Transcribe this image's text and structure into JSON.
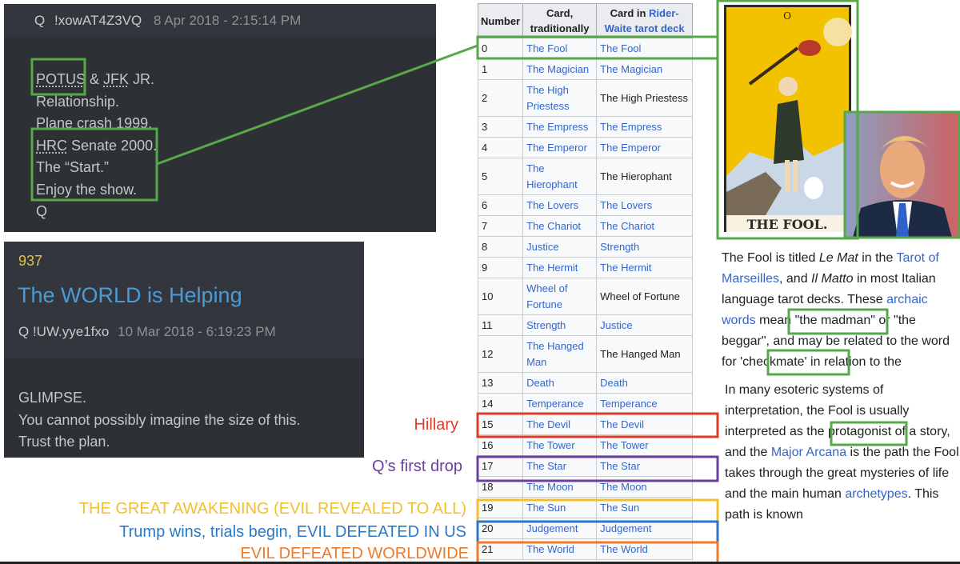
{
  "post1": {
    "q": "Q",
    "trip": "!xowAT4Z3VQ",
    "timestamp": "8 Apr 2018 - 2:15:14 PM",
    "potus": "POTUS",
    "amp": " & ",
    "jfk": "JFK",
    "jr": " JR.",
    "line2": "Relationship.",
    "line3": "Plane crash 1999.",
    "hrc": "HRC",
    "senate": " Senate 2000.",
    "line5": "The “Start.”",
    "line6": "Enjoy the show.",
    "sign": "Q"
  },
  "post2": {
    "number": "937",
    "title": "The WORLD is Helping",
    "trip": "Q  !UW.yye1fxo",
    "timestamp": "10 Mar 2018 - 6:19:23 PM",
    "line1": "GLIMPSE.",
    "line2": "You cannot possibly imagine the size of this.",
    "line3": "Trust the plan."
  },
  "table": {
    "head_number": "Number",
    "head_trad": "Card, traditionally",
    "head_rw_prefix": "Card in ",
    "head_rw_link": "Rider-Waite tarot deck",
    "rows": [
      {
        "n": "0",
        "trad": "The Fool",
        "rw": "The Fool",
        "rw_link": true
      },
      {
        "n": "1",
        "trad": "The Magician",
        "rw": "The Magician",
        "rw_link": true
      },
      {
        "n": "2",
        "trad": "The High Priestess",
        "rw": "The High Priestess",
        "rw_link": false
      },
      {
        "n": "3",
        "trad": "The Empress",
        "rw": "The Empress",
        "rw_link": true
      },
      {
        "n": "4",
        "trad": "The Emperor",
        "rw": "The Emperor",
        "rw_link": true
      },
      {
        "n": "5",
        "trad": "The Hierophant",
        "rw": "The Hierophant",
        "rw_link": false
      },
      {
        "n": "6",
        "trad": "The Lovers",
        "rw": "The Lovers",
        "rw_link": true
      },
      {
        "n": "7",
        "trad": "The Chariot",
        "rw": "The Chariot",
        "rw_link": true
      },
      {
        "n": "8",
        "trad": "Justice",
        "rw": "Strength",
        "rw_link": true
      },
      {
        "n": "9",
        "trad": "The Hermit",
        "rw": "The Hermit",
        "rw_link": true
      },
      {
        "n": "10",
        "trad": "Wheel of Fortune",
        "rw": "Wheel of Fortune",
        "rw_link": false
      },
      {
        "n": "11",
        "trad": "Strength",
        "rw": "Justice",
        "rw_link": true
      },
      {
        "n": "12",
        "trad": "The Hanged Man",
        "rw": "The Hanged Man",
        "rw_link": false
      },
      {
        "n": "13",
        "trad": "Death",
        "rw": "Death",
        "rw_link": true
      },
      {
        "n": "14",
        "trad": "Temperance",
        "rw": "Temperance",
        "rw_link": true
      },
      {
        "n": "15",
        "trad": "The Devil",
        "rw": "The Devil",
        "rw_link": true
      },
      {
        "n": "16",
        "trad": "The Tower",
        "rw": "The Tower",
        "rw_link": true
      },
      {
        "n": "17",
        "trad": "The Star",
        "rw": "The Star",
        "rw_link": true
      },
      {
        "n": "18",
        "trad": "The Moon",
        "rw": "The Moon",
        "rw_link": true
      },
      {
        "n": "19",
        "trad": "The Sun",
        "rw": "The Sun",
        "rw_link": true
      },
      {
        "n": "20",
        "trad": "Judgement",
        "rw": "Judgement",
        "rw_link": true
      },
      {
        "n": "21",
        "trad": "The World",
        "rw": "The World",
        "rw_link": true
      }
    ]
  },
  "labels": {
    "hillary": "Hillary",
    "first_drop": "Q’s first drop",
    "awakening": "THE GREAT AWAKENING (EVIL REVEALED TO ALL)",
    "trump": "Trump wins, trials begin, EVIL DEFEATED IN US",
    "worldwide": "EVIL DEFEATED WORLDWIDE"
  },
  "card": {
    "numeral": "O",
    "title": "THE FOOL."
  },
  "article": {
    "p1_a": "The Fool is titled ",
    "p1_lemat": "Le Mat",
    "p1_b": " in the ",
    "p1_tarot_link": "Tarot of Marseilles",
    "p1_c": ", and ",
    "p1_ilmatto": "Il Matto",
    "p1_d": " in most Italian language tarot decks. These ",
    "p1_archaic_link": "archaic words",
    "p1_e": " mean ",
    "p1_madman": "\"the madman\"",
    "p1_f": " or \"the beggar\", and may be related to the word for ",
    "p1_checkmate": "'checkmate'",
    "p1_g": " in relation to the",
    "p2_a": "In many esoteric systems of interpretation, the Fool is usually interpreted as the ",
    "p2_protagonist": "protagonist",
    "p2_b": " of a story, and the ",
    "p2_arcana_link": "Major Arcana",
    "p2_c": " is the path the Fool takes through the great mysteries of life and the main human ",
    "p2_archetypes_link": "archetypes",
    "p2_d": ". This path is known"
  },
  "colors": {
    "green": "#56a84a",
    "red": "#e03a2a",
    "purple": "#6a3fa0",
    "yellow": "#f0c030",
    "blue": "#2d78c4",
    "orange": "#f07a28",
    "link": "#3366cc"
  }
}
